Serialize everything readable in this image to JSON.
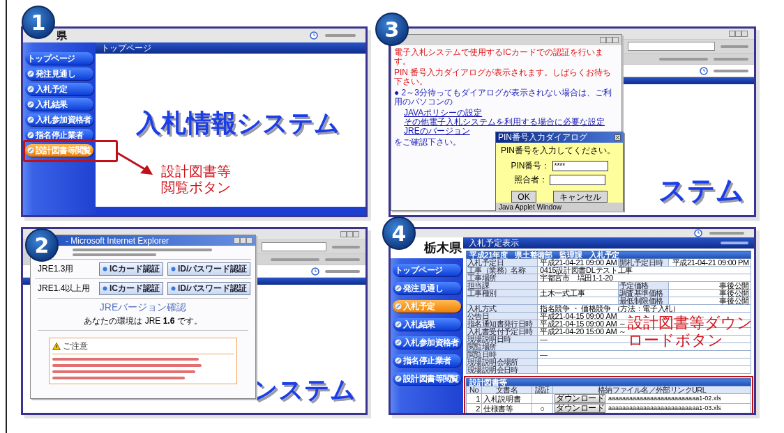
{
  "panels": [
    {
      "kind": "top",
      "badge": "1",
      "logo": "県",
      "header": "トップページ",
      "sidebar": [
        {
          "label": "トップページ",
          "icon": false,
          "selected": false
        },
        {
          "label": "発注見通し",
          "icon": true,
          "selected": false
        },
        {
          "label": "入札予定",
          "icon": true,
          "selected": false
        },
        {
          "label": "入札結果",
          "icon": true,
          "selected": false
        },
        {
          "label": "入札参加資格者",
          "icon": true,
          "selected": false
        },
        {
          "label": "指名停止業者",
          "icon": true,
          "selected": false
        },
        {
          "label": "設計図書等閲覧",
          "icon": true,
          "selected": true
        }
      ],
      "hero": "入札情報システム",
      "callout": [
        "設計図書等",
        "閲覧ボタン"
      ]
    },
    {
      "kind": "pin",
      "badge": "3",
      "hero": "ステム",
      "notice": {
        "lines": [
          "電子入札システムで使用するICカードでの認証を行います。",
          "PIN 番号入力ダイアログが表示されます。しばらくお待ち下さい。"
        ],
        "hint": "● 2～3分待ってもダイアログが表示されない場合は、ご利用のパソコンの",
        "links": [
          "JAVAポリシーの設定",
          "その他電子入札システムを利用する場合に必要な設定",
          "JREのバージョン"
        ],
        "confirm": "をご確認下さい。"
      },
      "dialog": {
        "title": "PIN番号入力ダイアログ",
        "prompt": "PIN番号を入力してください。",
        "fields": [
          {
            "label": "PIN番号：",
            "value": "****"
          },
          {
            "label": "照合者："
          }
        ],
        "buttons": [
          "OK",
          "キャンセル"
        ],
        "status": "Java Applet Window"
      }
    },
    {
      "kind": "jre",
      "badge": "2",
      "hero": "ンステム",
      "window_title": "- Microsoft Internet Explorer",
      "rows": [
        {
          "label": "JRE1.3用",
          "buttons": [
            "ICカード認証",
            "ID/パスワード認証"
          ]
        },
        {
          "label": "JRE1.4以上用",
          "buttons": [
            "ICカード認証",
            "ID/パスワード認証"
          ]
        }
      ],
      "heading": "JREバージョン確認",
      "environment": "あなたの環境は JRE **1.6** です。",
      "warning_title": "ご注意"
    },
    {
      "kind": "schedule",
      "badge": "4",
      "logo": "栃木県",
      "header": "入札予定表示",
      "sidebar": [
        {
          "label": "トップページ",
          "icon": false,
          "selected": false
        },
        {
          "label": "発注見通し",
          "icon": true,
          "selected": false
        },
        {
          "label": "入札予定",
          "icon": true,
          "selected": true
        },
        {
          "label": "入札結果",
          "icon": true,
          "selected": false
        },
        {
          "label": "入札参加資格者",
          "icon": true,
          "selected": false
        },
        {
          "label": "指名停止業者",
          "icon": true,
          "selected": false
        },
        {
          "label": "設計図書等閲覧",
          "icon": true,
          "selected": false
        }
      ],
      "table": {
        "title": "平成21年度　県土整備部　監理課　入札予定",
        "rows": [
          {
            "label": "入札予定日",
            "value": "平成21-04-21 09:00 AM",
            "side_label": "開札予定日時",
            "side_value": "平成21-04-21 09:00 PM"
          },
          {
            "label": "工事（業務）名称",
            "value": "0415設計図書DLテスト工事"
          },
          {
            "label": "工事場所",
            "value": "宇都宮市　塙田1-1-20"
          },
          {
            "label": "担当課",
            "side_label": "予定価格",
            "side_value": "事後公開"
          },
          {
            "label": "工事種別",
            "value": "土木一式工事",
            "side_label": "調査基準価格",
            "side_value": "事後公開"
          },
          {
            "side_label": "最低制限価格",
            "side_value": "事後公開"
          },
          {
            "label": "入札方式",
            "value": "指名競争 ・ 価格競争 （方法：電子入札）"
          },
          {
            "label": "公告日",
            "value": "平成21-04-15 09:00 AM"
          },
          {
            "label": "指名通知書発行日時",
            "value": "平成21-04-15 09:00 AM ～"
          },
          {
            "label": "入札書受付予定日時",
            "value": "平成21-04-20 15:00 AM ～"
          },
          {
            "label": "現場説明日時",
            "value": "—"
          },
          {
            "label": "閲覧場所"
          },
          {
            "label": "閲覧日時",
            "value": "—"
          },
          {
            "label": "現場説明会場所"
          },
          {
            "label": "現場説明会日時"
          }
        ]
      },
      "documents": {
        "title": "設計図書等",
        "columns": [
          "No",
          "文書名",
          "認証",
          "格納ファイル名／外部リンクURL"
        ],
        "rows": [
          {
            "no": "1",
            "name": "入札説明書",
            "button": "ダウンロード",
            "file": "aaaaaaaaaaaaaaaaaaaaaaaaaa1-02.xls"
          },
          {
            "no": "2",
            "name": "仕様書等",
            "auth": "○",
            "button": "ダウンロード",
            "file": "aaaaaaaaaaaaaaaaaaaaaaaaaa1-03.xls"
          }
        ]
      },
      "callout": [
        "設計図書等ダウン",
        "ロードボタン"
      ]
    }
  ]
}
